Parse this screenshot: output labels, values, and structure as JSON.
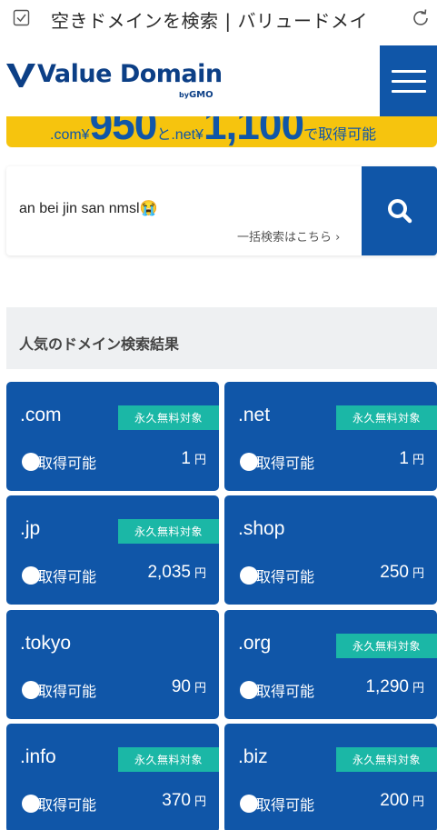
{
  "browser": {
    "title": "空きドメインを検索 | バリュードメイ"
  },
  "header": {
    "logo_text": "Value Domain",
    "logo_sub_by": "by",
    "logo_sub_brand": "GMO"
  },
  "promo": {
    "com_label": ".com",
    "yen1": "¥",
    "price1": "950",
    "and": "と",
    "net_label": ".net",
    "yen2": "¥",
    "price2": "1,100",
    "suffix": "で取得可能"
  },
  "search": {
    "value": "an bei jin san nmsl😭",
    "bulk_link": "一括検索はこちら ›"
  },
  "popular": {
    "title": "人気のドメイン検索結果",
    "badge_label": "永久無料対象",
    "yen_unit": "円",
    "domains": [
      {
        "tld": ".com",
        "badge": "永久無料対象",
        "status": "取得可能",
        "price": "1"
      },
      {
        "tld": ".net",
        "badge": "永久無料対象",
        "status": "取得可能",
        "price": "1"
      },
      {
        "tld": ".jp",
        "badge": "永久無料対象",
        "status": "取得可能",
        "price": "2,035"
      },
      {
        "tld": ".shop",
        "badge": "",
        "status": "取得可能",
        "price": "250"
      },
      {
        "tld": ".tokyo",
        "badge": "",
        "status": "取得可能",
        "price": "90"
      },
      {
        "tld": ".org",
        "badge": "永久無料対象",
        "status": "取得可能",
        "price": "1,290"
      },
      {
        "tld": ".info",
        "badge": "永久無料対象",
        "status": "取得可能",
        "price": "370"
      },
      {
        "tld": ".biz",
        "badge": "永久無料対象",
        "status": "取得可能",
        "price": "200"
      }
    ]
  },
  "colors": {
    "brand_blue": "#1056a8",
    "logo_navy": "#0c3f86",
    "promo_yellow": "#f6c40e",
    "badge_teal": "#1bb7a6"
  }
}
